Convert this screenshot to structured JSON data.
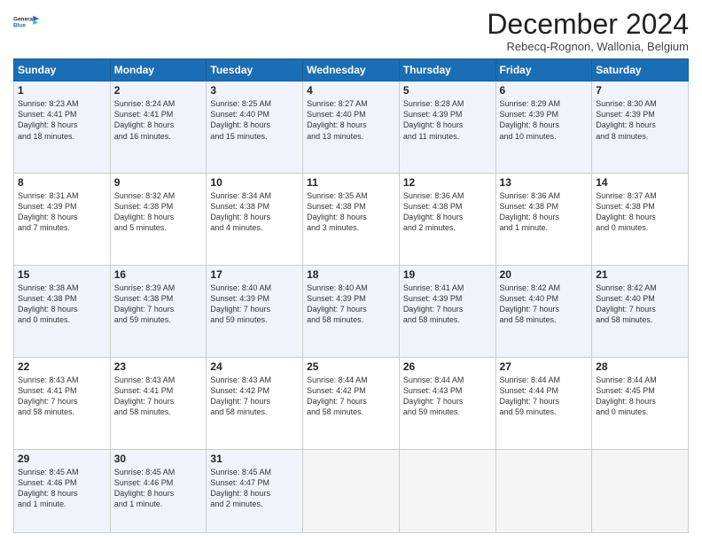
{
  "logo": {
    "line1": "General",
    "line2": "Blue",
    "icon_color": "#1a6eb5"
  },
  "header": {
    "month": "December 2024",
    "location": "Rebecq-Rognon, Wallonia, Belgium"
  },
  "weekdays": [
    "Sunday",
    "Monday",
    "Tuesday",
    "Wednesday",
    "Thursday",
    "Friday",
    "Saturday"
  ],
  "weeks": [
    [
      {
        "day": "1",
        "text": "Sunrise: 8:23 AM\nSunset: 4:41 PM\nDaylight: 8 hours\nand 18 minutes."
      },
      {
        "day": "2",
        "text": "Sunrise: 8:24 AM\nSunset: 4:41 PM\nDaylight: 8 hours\nand 16 minutes."
      },
      {
        "day": "3",
        "text": "Sunrise: 8:25 AM\nSunset: 4:40 PM\nDaylight: 8 hours\nand 15 minutes."
      },
      {
        "day": "4",
        "text": "Sunrise: 8:27 AM\nSunset: 4:40 PM\nDaylight: 8 hours\nand 13 minutes."
      },
      {
        "day": "5",
        "text": "Sunrise: 8:28 AM\nSunset: 4:39 PM\nDaylight: 8 hours\nand 11 minutes."
      },
      {
        "day": "6",
        "text": "Sunrise: 8:29 AM\nSunset: 4:39 PM\nDaylight: 8 hours\nand 10 minutes."
      },
      {
        "day": "7",
        "text": "Sunrise: 8:30 AM\nSunset: 4:39 PM\nDaylight: 8 hours\nand 8 minutes."
      }
    ],
    [
      {
        "day": "8",
        "text": "Sunrise: 8:31 AM\nSunset: 4:39 PM\nDaylight: 8 hours\nand 7 minutes."
      },
      {
        "day": "9",
        "text": "Sunrise: 8:32 AM\nSunset: 4:38 PM\nDaylight: 8 hours\nand 5 minutes."
      },
      {
        "day": "10",
        "text": "Sunrise: 8:34 AM\nSunset: 4:38 PM\nDaylight: 8 hours\nand 4 minutes."
      },
      {
        "day": "11",
        "text": "Sunrise: 8:35 AM\nSunset: 4:38 PM\nDaylight: 8 hours\nand 3 minutes."
      },
      {
        "day": "12",
        "text": "Sunrise: 8:36 AM\nSunset: 4:38 PM\nDaylight: 8 hours\nand 2 minutes."
      },
      {
        "day": "13",
        "text": "Sunrise: 8:36 AM\nSunset: 4:38 PM\nDaylight: 8 hours\nand 1 minute."
      },
      {
        "day": "14",
        "text": "Sunrise: 8:37 AM\nSunset: 4:38 PM\nDaylight: 8 hours\nand 0 minutes."
      }
    ],
    [
      {
        "day": "15",
        "text": "Sunrise: 8:38 AM\nSunset: 4:38 PM\nDaylight: 8 hours\nand 0 minutes."
      },
      {
        "day": "16",
        "text": "Sunrise: 8:39 AM\nSunset: 4:38 PM\nDaylight: 7 hours\nand 59 minutes."
      },
      {
        "day": "17",
        "text": "Sunrise: 8:40 AM\nSunset: 4:39 PM\nDaylight: 7 hours\nand 59 minutes."
      },
      {
        "day": "18",
        "text": "Sunrise: 8:40 AM\nSunset: 4:39 PM\nDaylight: 7 hours\nand 58 minutes."
      },
      {
        "day": "19",
        "text": "Sunrise: 8:41 AM\nSunset: 4:39 PM\nDaylight: 7 hours\nand 58 minutes."
      },
      {
        "day": "20",
        "text": "Sunrise: 8:42 AM\nSunset: 4:40 PM\nDaylight: 7 hours\nand 58 minutes."
      },
      {
        "day": "21",
        "text": "Sunrise: 8:42 AM\nSunset: 4:40 PM\nDaylight: 7 hours\nand 58 minutes."
      }
    ],
    [
      {
        "day": "22",
        "text": "Sunrise: 8:43 AM\nSunset: 4:41 PM\nDaylight: 7 hours\nand 58 minutes."
      },
      {
        "day": "23",
        "text": "Sunrise: 8:43 AM\nSunset: 4:41 PM\nDaylight: 7 hours\nand 58 minutes."
      },
      {
        "day": "24",
        "text": "Sunrise: 8:43 AM\nSunset: 4:42 PM\nDaylight: 7 hours\nand 58 minutes."
      },
      {
        "day": "25",
        "text": "Sunrise: 8:44 AM\nSunset: 4:42 PM\nDaylight: 7 hours\nand 58 minutes."
      },
      {
        "day": "26",
        "text": "Sunrise: 8:44 AM\nSunset: 4:43 PM\nDaylight: 7 hours\nand 59 minutes."
      },
      {
        "day": "27",
        "text": "Sunrise: 8:44 AM\nSunset: 4:44 PM\nDaylight: 7 hours\nand 59 minutes."
      },
      {
        "day": "28",
        "text": "Sunrise: 8:44 AM\nSunset: 4:45 PM\nDaylight: 8 hours\nand 0 minutes."
      }
    ],
    [
      {
        "day": "29",
        "text": "Sunrise: 8:45 AM\nSunset: 4:46 PM\nDaylight: 8 hours\nand 1 minute."
      },
      {
        "day": "30",
        "text": "Sunrise: 8:45 AM\nSunset: 4:46 PM\nDaylight: 8 hours\nand 1 minute."
      },
      {
        "day": "31",
        "text": "Sunrise: 8:45 AM\nSunset: 4:47 PM\nDaylight: 8 hours\nand 2 minutes."
      },
      {
        "day": "",
        "text": ""
      },
      {
        "day": "",
        "text": ""
      },
      {
        "day": "",
        "text": ""
      },
      {
        "day": "",
        "text": ""
      }
    ]
  ]
}
